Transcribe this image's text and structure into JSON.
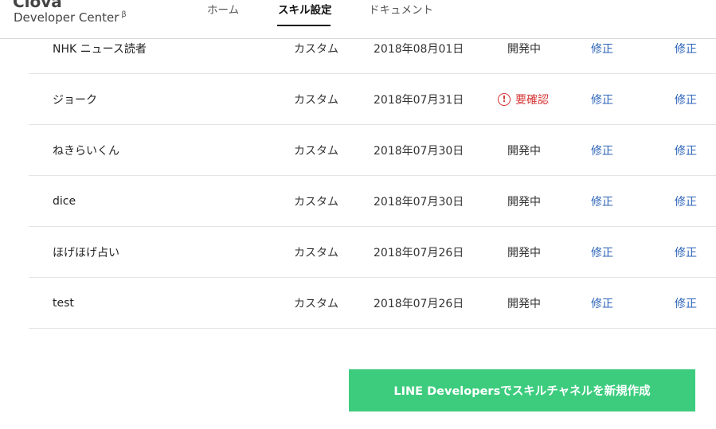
{
  "header": {
    "logo": "Clova",
    "subtitle": "Developer Center",
    "beta_mark": "β",
    "tabs": [
      {
        "label": "ホーム",
        "active": false
      },
      {
        "label": "スキル設定",
        "active": true
      },
      {
        "label": "ドキュメント",
        "active": false
      }
    ]
  },
  "skills": [
    {
      "name": "NHK ニュース読者",
      "type": "カスタム",
      "date": "2018年08月01日",
      "status": "開発中",
      "status_warn": false,
      "edit1": "修正",
      "edit2": "修正"
    },
    {
      "name": "ジョーク",
      "type": "カスタム",
      "date": "2018年07月31日",
      "status": "要確認",
      "status_warn": true,
      "edit1": "修正",
      "edit2": "修正"
    },
    {
      "name": "ねきらいくん",
      "type": "カスタム",
      "date": "2018年07月30日",
      "status": "開発中",
      "status_warn": false,
      "edit1": "修正",
      "edit2": "修正"
    },
    {
      "name": "dice",
      "type": "カスタム",
      "date": "2018年07月30日",
      "status": "開発中",
      "status_warn": false,
      "edit1": "修正",
      "edit2": "修正"
    },
    {
      "name": "ほげほげ占い",
      "type": "カスタム",
      "date": "2018年07月26日",
      "status": "開発中",
      "status_warn": false,
      "edit1": "修正",
      "edit2": "修正"
    },
    {
      "name": "test",
      "type": "カスタム",
      "date": "2018年07月26日",
      "status": "開発中",
      "status_warn": false,
      "edit1": "修正",
      "edit2": "修正"
    }
  ],
  "warn_icon_glyph": "!",
  "create_button": {
    "label": "LINE Developersでスキルチャネルを新規作成",
    "color": "#3dcc7e"
  },
  "colors": {
    "link": "#2a62b8",
    "warning": "#d53333"
  }
}
